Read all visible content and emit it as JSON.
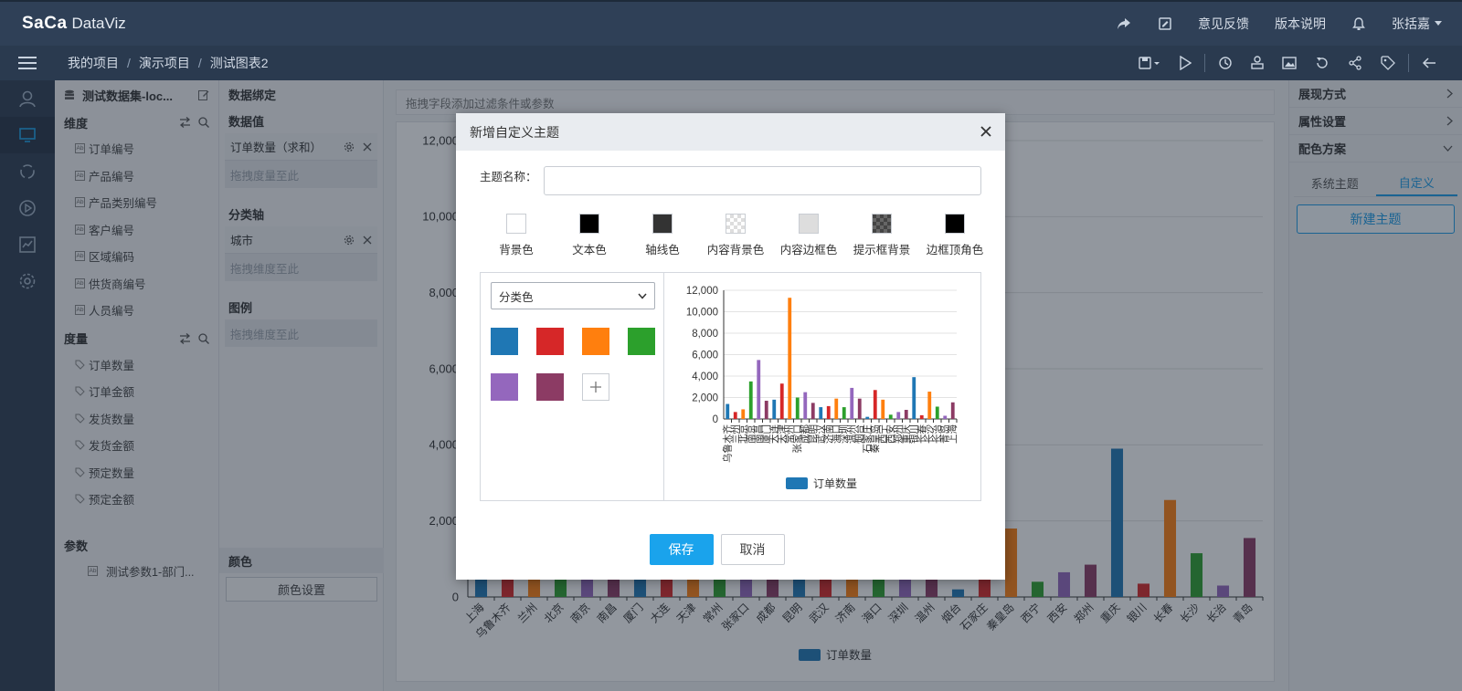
{
  "app": {
    "logo_part1": "SaCa",
    "logo_part2": "DataViz"
  },
  "topbar": {
    "feedback": "意见反馈",
    "release_notes": "版本说明",
    "user": "张括嘉"
  },
  "breadcrumb": [
    "我的项目",
    "演示项目",
    "测试图表2"
  ],
  "dataset": {
    "title": "测试数据集-loc...",
    "dimension_label": "维度",
    "dimensions": [
      "订单编号",
      "产品编号",
      "产品类别编号",
      "客户编号",
      "区域编码",
      "供货商编号",
      "人员编号"
    ],
    "measure_label": "度量",
    "measures": [
      "订单数量",
      "订单金额",
      "发货数量",
      "发货金额",
      "预定数量",
      "预定金额"
    ],
    "params_label": "参数",
    "params": [
      "测试参数1-部门..."
    ]
  },
  "binding": {
    "title": "数据绑定",
    "value_label": "数据值",
    "value_pill": "订单数量（求和）",
    "value_hint": "拖拽度量至此",
    "axis_label": "分类轴",
    "axis_pill": "城市",
    "axis_hint": "拖拽维度至此",
    "legend_label": "图例",
    "legend_hint": "拖拽维度至此",
    "color_label": "颜色",
    "color_button": "颜色设置"
  },
  "main": {
    "filter_hint": "拖拽字段添加过滤条件或参数"
  },
  "right_panel": {
    "display_mode": "展现方式",
    "property_settings": "属性设置",
    "color_scheme": "配色方案",
    "tabs": [
      "系统主题",
      "自定义"
    ],
    "active_tab": 1,
    "new_theme": "新建主题"
  },
  "dialog": {
    "title": "新增自定义主题",
    "name_label": "主题名称：",
    "name_value": "",
    "swatches": [
      {
        "label": "背景色",
        "color": "#ffffff",
        "pattern": ""
      },
      {
        "label": "文本色",
        "color": "#000000",
        "pattern": ""
      },
      {
        "label": "轴线色",
        "color": "#333333",
        "pattern": ""
      },
      {
        "label": "内容背景色",
        "color": "#ffffff",
        "pattern": "checker"
      },
      {
        "label": "内容边框色",
        "color": "#dddddd",
        "pattern": ""
      },
      {
        "label": "提示框背景",
        "color": "#444444",
        "pattern": "checker-dark"
      },
      {
        "label": "边框顶角色",
        "color": "#000000",
        "pattern": ""
      }
    ],
    "palette_select": "分类色",
    "palette": [
      "#1f77b4",
      "#d62728",
      "#ff7f0e",
      "#2ca02c",
      "#9467bd",
      "#8c3b64"
    ],
    "save": "保存",
    "cancel": "取消"
  },
  "chart_data": [
    {
      "type": "bar",
      "title": "",
      "xlabel": "",
      "ylabel": "",
      "ylim": [
        0,
        12000
      ],
      "yticks": [
        0,
        2000,
        4000,
        6000,
        8000,
        10000,
        12000
      ],
      "legend": "订单数量",
      "legend_position": "bottom",
      "grid": true,
      "categories": [
        "上海",
        "乌鲁木齐",
        "兰州",
        "北京",
        "南京",
        "南昌",
        "厦门",
        "大连",
        "天津",
        "常州",
        "张家口",
        "成都",
        "昆明",
        "武汉",
        "济南",
        "海口",
        "深圳",
        "温州",
        "烟台",
        "石家庄",
        "秦皇岛",
        "西宁",
        "西安",
        "郑州",
        "重庆",
        "银川",
        "长春",
        "长沙",
        "长治",
        "青岛"
      ],
      "values": [
        1400,
        650,
        900,
        3500,
        5500,
        1700,
        1800,
        3300,
        11300,
        2000,
        2500,
        1500,
        1100,
        1200,
        1900,
        1100,
        2900,
        1900,
        200,
        2700,
        1800,
        400,
        650,
        850,
        3900,
        350,
        2550,
        1150,
        300,
        1550
      ],
      "series_colors_cycle": [
        "#1f77b4",
        "#d62728",
        "#ff7f0e",
        "#2ca02c",
        "#9467bd",
        "#8c3b64"
      ],
      "series": [
        {
          "name": "订单数量",
          "values": [
            1400,
            650,
            900,
            3500,
            5500,
            1700,
            1800,
            3300,
            11300,
            2000,
            2500,
            1500,
            1100,
            1200,
            1900,
            1100,
            2900,
            1900,
            200,
            2700,
            1800,
            400,
            650,
            850,
            3900,
            350,
            2550,
            1150,
            300,
            1550
          ]
        }
      ]
    },
    {
      "type": "bar",
      "title": "",
      "xlabel": "",
      "ylabel": "",
      "ylim": [
        0,
        12000
      ],
      "yticks": [
        0,
        2000,
        4000,
        6000,
        8000,
        10000,
        12000
      ],
      "legend": "订单数量",
      "legend_position": "bottom",
      "grid": true,
      "categories": [
        "乌鲁木齐",
        "兰州",
        "北京",
        "南京",
        "南昌",
        "厦门",
        "大连",
        "天津",
        "常州",
        "张家口",
        "成都",
        "昆明",
        "武汉",
        "济南",
        "海口",
        "深圳",
        "温州",
        "烟台",
        "石家庄",
        "秦皇岛",
        "西宁",
        "西安",
        "郑州",
        "重庆",
        "银川",
        "长春",
        "长沙",
        "长治",
        "青岛",
        "上海"
      ],
      "values": [
        1400,
        650,
        900,
        3500,
        5500,
        1700,
        1800,
        3300,
        11300,
        2000,
        2500,
        1500,
        1100,
        1200,
        1900,
        1100,
        2900,
        1900,
        200,
        2700,
        1800,
        400,
        650,
        850,
        3900,
        350,
        2550,
        1150,
        300,
        1550
      ],
      "series": [
        {
          "name": "订单数量",
          "values": [
            1400,
            650,
            900,
            3500,
            5500,
            1700,
            1800,
            3300,
            11300,
            2000,
            2500,
            1500,
            1100,
            1200,
            1900,
            1100,
            2900,
            1900,
            200,
            2700,
            1800,
            400,
            650,
            850,
            3900,
            350,
            2550,
            1150,
            300,
            1550
          ]
        }
      ]
    }
  ]
}
